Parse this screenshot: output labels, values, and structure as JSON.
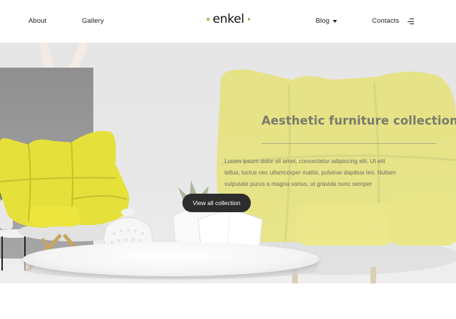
{
  "header": {
    "nav_left": [
      "About",
      "Gallery"
    ],
    "logo_text": "enkel",
    "nav_right": [
      "Blog",
      "Contacts"
    ],
    "blog_has_dropdown": true,
    "menu_icon": "menu-lines-icon"
  },
  "hero": {
    "title": "Aesthetic furniture collection",
    "description_line1": "Lorem ipsum dolor sit amet, consectetur adipiscing elit. Ut elit",
    "description_line2": "tellus, luctus nec ullamcorper mattis, pulvinar dapibus leo. Nullam",
    "description_line3": "vulputate purus a magna varius, ut gravida nunc semper",
    "cta_label": "View all collection"
  },
  "colors": {
    "accent": "#c8a94a",
    "chair_yellow": "#e6e03a",
    "button_bg": "#2d2d2d"
  }
}
